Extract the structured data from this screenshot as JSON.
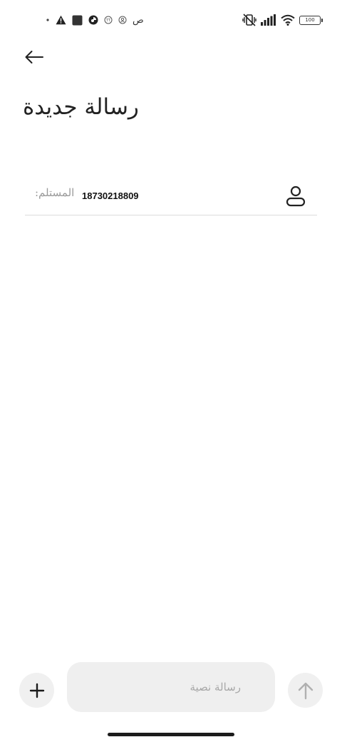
{
  "status_bar": {
    "time": "ص",
    "battery_level": "100",
    "left_icons": [
      "notification-badge-icon",
      "notification-badge-icon",
      "app-status-icon",
      "square-app-icon",
      "warning-icon",
      "dot-icon"
    ],
    "right_icons": [
      "vibrate-off-icon",
      "signal-icon",
      "wifi-icon",
      "battery-icon"
    ]
  },
  "header": {
    "back_icon": "arrow-left-icon",
    "title": "رسالة جديدة"
  },
  "recipient": {
    "label": "المستلم:",
    "value": "18730218809",
    "contact_icon": "person-icon"
  },
  "compose": {
    "attach_icon": "plus-icon",
    "placeholder": "رسالة نصية",
    "send_icon": "arrow-up-icon"
  },
  "colors": {
    "background": "#ffffff",
    "button_bg": "#f0f0f0",
    "input_bg": "#efefef",
    "placeholder": "#a8a8a8",
    "divider": "#dcdcdc",
    "disabled_icon": "#b0b0b0"
  }
}
